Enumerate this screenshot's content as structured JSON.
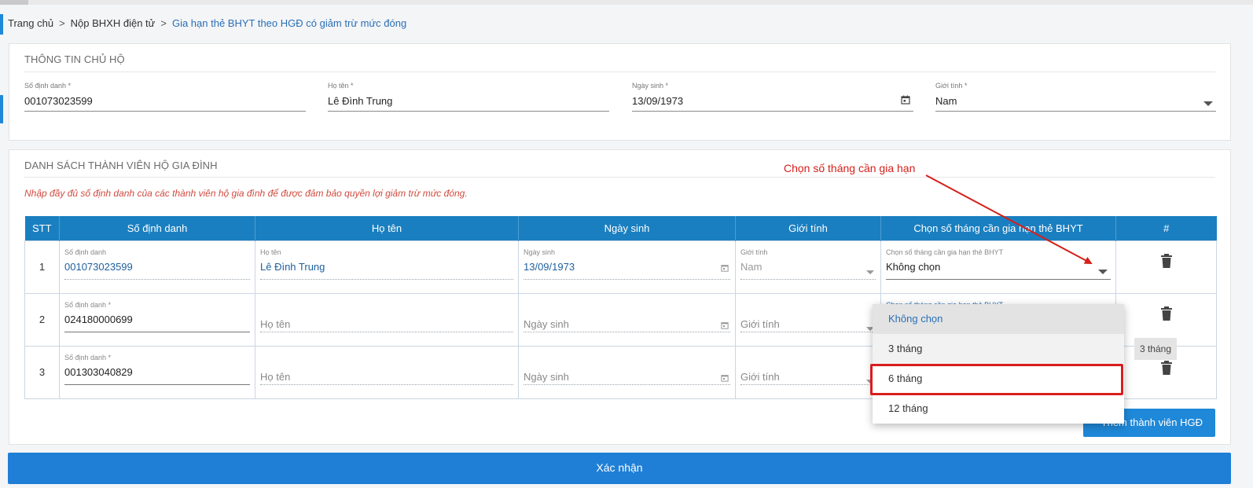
{
  "breadcrumb": {
    "items": [
      "Trang chủ",
      "Nộp BHXH điện tử"
    ],
    "current": "Gia hạn thẻ BHYT theo HGĐ có giảm trừ mức đóng",
    "separator": ">"
  },
  "head": {
    "title": "THÔNG TIN CHỦ HỘ",
    "id": {
      "label": "Số định danh *",
      "value": "001073023599"
    },
    "name": {
      "label": "Họ tên *",
      "value": "Lê Đình Trung"
    },
    "dob": {
      "label": "Ngày sinh *",
      "value": "13/09/1973"
    },
    "gender": {
      "label": "Giới tính *",
      "value": "Nam"
    }
  },
  "members": {
    "title": "DANH SÁCH THÀNH VIÊN HỘ GIA ĐÌNH",
    "note": "Nhập đầy đủ số định danh của các thành viên hộ gia đình để được đảm bảo quyền lợi giảm trừ mức đóng.",
    "columns": [
      "STT",
      "Số định danh",
      "Họ tên",
      "Ngày sinh",
      "Giới tính",
      "Chọn số tháng cần gia hạn thẻ BHYT",
      "#"
    ],
    "rows": [
      {
        "stt": "1",
        "id_label": "Số định danh",
        "id": "001073023599",
        "name_label": "Họ tên",
        "name": "Lê Đình Trung",
        "dob_label": "Ngày sinh",
        "dob": "13/09/1973",
        "gender_label": "Giới tính",
        "gender": "Nam",
        "months_label": "Chọn số tháng cần gia hạn thẻ BHYT",
        "months": "Không chọn"
      },
      {
        "stt": "2",
        "id_label": "Số định danh *",
        "id": "024180000699",
        "name_ph": "Họ tên",
        "dob_ph": "Ngày sinh",
        "gender_ph": "Giới tính",
        "months_label": "Chọn số tháng cần gia hạn thẻ BHYT"
      },
      {
        "stt": "3",
        "id_label": "Số định danh *",
        "id": "001303040829",
        "name_ph": "Họ tên",
        "dob_ph": "Ngày sinh",
        "gender_ph": "Giới tính"
      }
    ]
  },
  "dropdown": {
    "options": [
      "Không chọn",
      "3 tháng",
      "6 tháng",
      "12 tháng"
    ],
    "selected": "Không chọn",
    "highlighted": "6 tháng"
  },
  "tooltip": "3 tháng",
  "add_member_button": "Thêm thành viên HGĐ",
  "confirm_button": "Xác nhận",
  "annotation": "Chọn số tháng cần gia hạn",
  "colors": {
    "header": "#1a7fc0",
    "primary": "#1f88d8",
    "annotation": "#d4201b",
    "note": "#d14b3f"
  },
  "icons": [
    "calendar-icon",
    "caret-down-icon",
    "trash-icon"
  ]
}
